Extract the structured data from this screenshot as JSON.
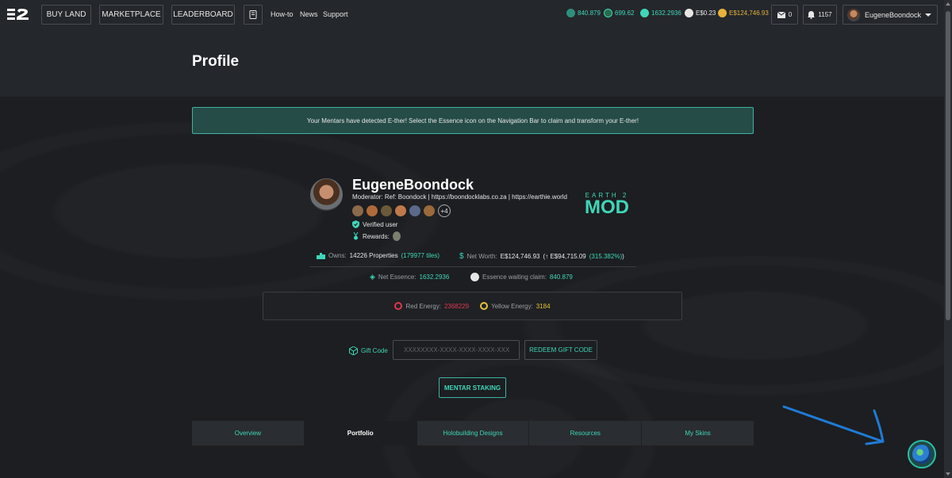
{
  "nav": {
    "buy_land": "BUY LAND",
    "marketplace": "MARKETPLACE",
    "leaderboard": "LEADERBOARD",
    "howto": "How-to",
    "news": "News",
    "support": "Support"
  },
  "stats": {
    "essence_claim": "840.879",
    "stat2": "699.62",
    "net_essence": "1632.2936",
    "cash": "E$0.23",
    "net_worth": "E$124,746.93",
    "messages": "0",
    "notifications": "1157",
    "username": "EugeneBoondock"
  },
  "page": {
    "title": "Profile"
  },
  "notice": "Your Mentars have detected E-ther! Select the Essence icon on the Navigation Bar to claim and transform your E-ther!",
  "profile": {
    "name": "EugeneBoondock",
    "bio": "Moderator: Ref: Boondock | https://boondocklabs.co.za | https://earthie.world",
    "extra_badges": "+4",
    "verified": "Verified user",
    "rewards": "Rewards:",
    "mod_top": "EARTH 2",
    "mod_text": "MOD"
  },
  "holdings": {
    "owns_label": "Owns:",
    "owns_value": "14226 Properties",
    "tiles": "(179977 tiles)",
    "networth_label": "Net Worth:",
    "networth_value": "E$124,746.93",
    "gain_prefix": "(↑ E$94,715.09",
    "gain_pct": "(315.382%)",
    "gain_suffix": ")",
    "essence_label": "Net Essence:",
    "essence_value": "1632.2936",
    "waiting_label": "Essence waiting claim:",
    "waiting_value": "840.879"
  },
  "energy": {
    "red_label": "Red Energy:",
    "red_value": "2368229",
    "yellow_label": "Yellow Energy:",
    "yellow_value": "3184"
  },
  "gift": {
    "label": "Gift Code",
    "placeholder": "XXXXXXXX-XXXX-XXXX-XXXX-XXX",
    "redeem": "REDEEM GIFT CODE"
  },
  "staking": "MENTAR STAKING",
  "tabs": [
    "Overview",
    "Portfolio",
    "Holobuilding Designs",
    "Resources",
    "My Skins"
  ],
  "colors": {
    "accent": "#3fd6b8",
    "red": "#e0364f",
    "yellow": "#e6c33a",
    "net_worth": "#e6b23a"
  }
}
